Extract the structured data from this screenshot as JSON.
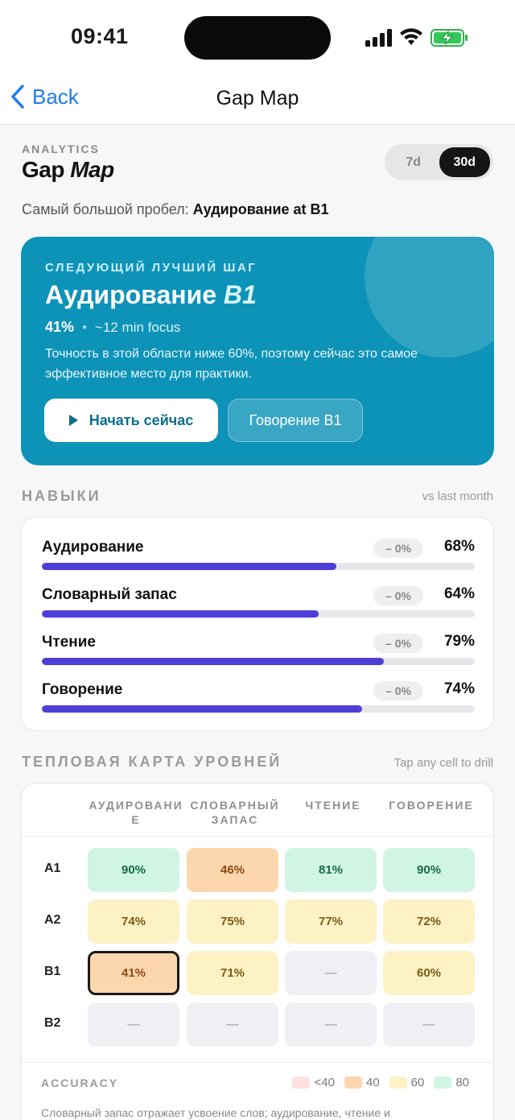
{
  "status": {
    "time": "09:41"
  },
  "nav": {
    "back_label": "Back",
    "title": "Gap Map"
  },
  "header": {
    "eyebrow": "ANALYTICS",
    "title_plain": "Gap ",
    "title_em": "Map",
    "range_options": [
      "7d",
      "30d"
    ],
    "range_selected": "30d",
    "biggest_gap_prefix": "Самый большой пробел: ",
    "biggest_gap_value": "Аудирование at B1"
  },
  "hero": {
    "eyebrow": "СЛЕДУЮЩИЙ ЛУЧШИЙ ШАГ",
    "title_plain": "Аудирование ",
    "title_em": "B1",
    "percent": "41%",
    "focus": "~12 min focus",
    "description": "Точность в этой области ниже 60%, поэтому сейчас это самое эффективное место для практики.",
    "primary_label": "Начать сейчас",
    "secondary_label": "Говорение B1",
    "color": "#0e93b8"
  },
  "skills": {
    "heading": "НАВЫКИ",
    "aside": "vs last month",
    "bar_color": "#4f3fd8",
    "items": [
      {
        "name": "Аудирование",
        "delta": "– 0%",
        "value": "68%",
        "fraction": 0.68
      },
      {
        "name": "Словарный запас",
        "delta": "– 0%",
        "value": "64%",
        "fraction": 0.64
      },
      {
        "name": "Чтение",
        "delta": "– 0%",
        "value": "79%",
        "fraction": 0.79
      },
      {
        "name": "Говорение",
        "delta": "– 0%",
        "value": "74%",
        "fraction": 0.74
      }
    ]
  },
  "heatmap": {
    "heading": "ТЕПЛОВАЯ КАРТА УРОВНЕЙ",
    "aside": "Tap any cell to drill",
    "columns": [
      "АУДИРОВАНИ Е",
      "СЛОВАРНЫЙ ЗАПАС",
      "ЧТЕНИЕ",
      "ГОВОРЕНИЕ"
    ],
    "rows": [
      {
        "level": "A1",
        "cells": [
          {
            "text": "90%",
            "band": "80"
          },
          {
            "text": "46%",
            "band": "40"
          },
          {
            "text": "81%",
            "band": "80"
          },
          {
            "text": "90%",
            "band": "80"
          }
        ]
      },
      {
        "level": "A2",
        "cells": [
          {
            "text": "74%",
            "band": "60"
          },
          {
            "text": "75%",
            "band": "60"
          },
          {
            "text": "77%",
            "band": "60"
          },
          {
            "text": "72%",
            "band": "60"
          }
        ]
      },
      {
        "level": "B1",
        "cells": [
          {
            "text": "41%",
            "band": "40",
            "selected": true
          },
          {
            "text": "71%",
            "band": "60"
          },
          {
            "text": "—",
            "band": "na"
          },
          {
            "text": "60%",
            "band": "60"
          }
        ]
      },
      {
        "level": "B2",
        "cells": [
          {
            "text": "—",
            "band": "na"
          },
          {
            "text": "—",
            "band": "na"
          },
          {
            "text": "—",
            "band": "na"
          },
          {
            "text": "—",
            "band": "na"
          }
        ]
      }
    ],
    "legend_title": "ACCURACY",
    "legend": [
      {
        "label": "<40",
        "color": "#fde0df"
      },
      {
        "label": "40",
        "color": "#fcd6ad"
      },
      {
        "label": "60",
        "color": "#fdf1c6"
      },
      {
        "label": "80",
        "color": "#d1f5e3"
      }
    ],
    "note": "Словарный запас отражает усвоение слов; аудирование, чтение и"
  }
}
